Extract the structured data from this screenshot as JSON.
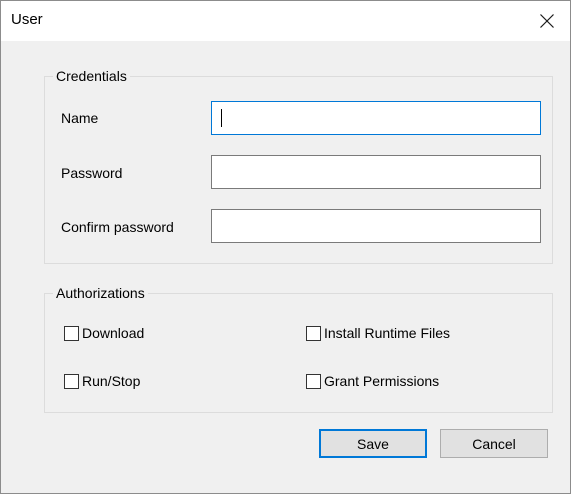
{
  "dialog": {
    "title": "User"
  },
  "credentials": {
    "legend": "Credentials",
    "name_label": "Name",
    "name_value": "",
    "password_label": "Password",
    "password_value": "",
    "confirm_label": "Confirm password",
    "confirm_value": ""
  },
  "authorizations": {
    "legend": "Authorizations",
    "items": [
      {
        "label": "Download",
        "checked": false
      },
      {
        "label": "Install Runtime Files",
        "checked": false
      },
      {
        "label": "Run/Stop",
        "checked": false
      },
      {
        "label": "Grant Permissions",
        "checked": false
      }
    ]
  },
  "buttons": {
    "save": "Save",
    "cancel": "Cancel"
  },
  "colors": {
    "focus_accent": "#0078d7",
    "window_bg": "#f0f0f0"
  },
  "icons": {
    "close": "close-icon"
  }
}
